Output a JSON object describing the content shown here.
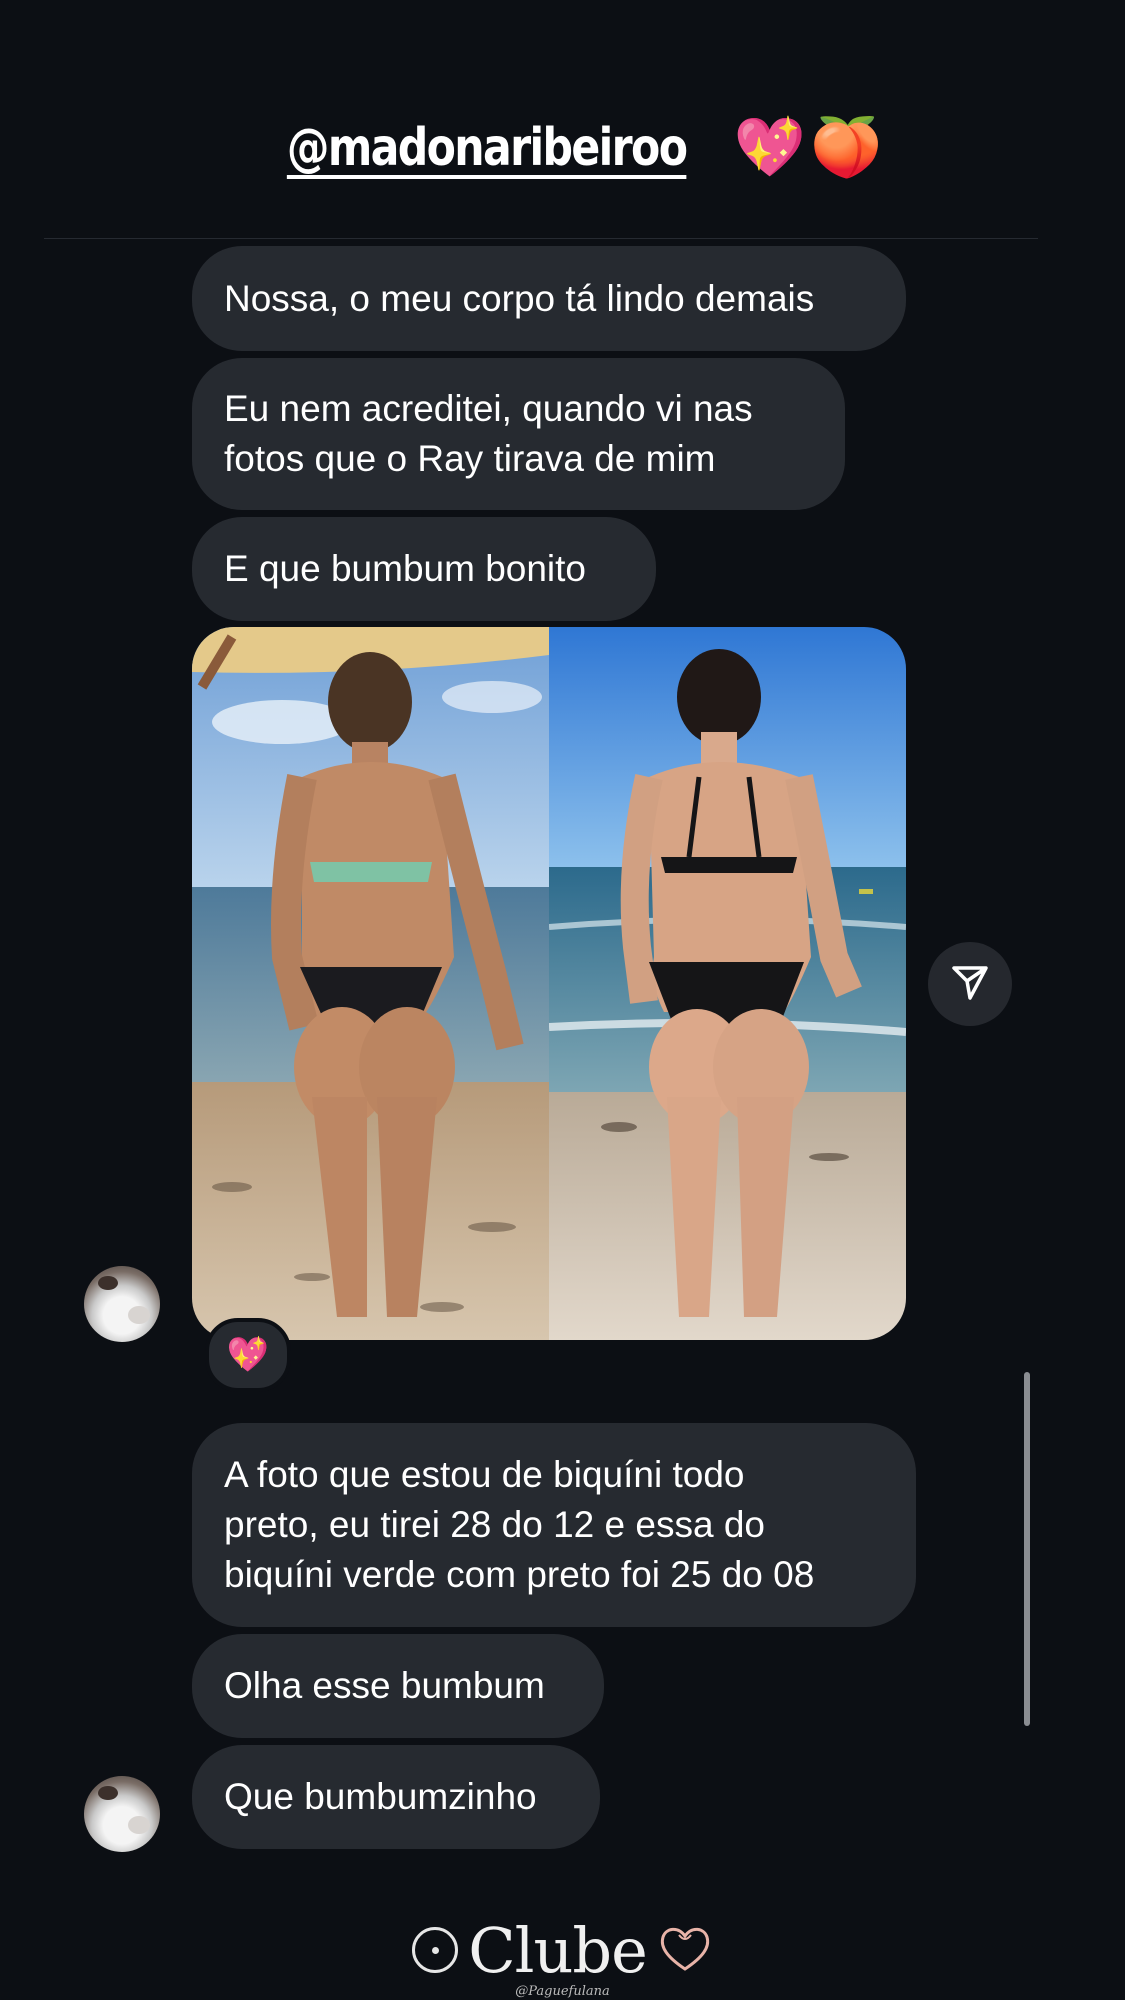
{
  "header": {
    "username": "@madonaribeiroo",
    "emoji_heart": "💖",
    "emoji_peach": "🍑"
  },
  "messages": [
    {
      "text": "Nossa, o meu corpo tá lindo demais"
    },
    {
      "lines": [
        "Eu nem acreditei, quando vi nas",
        "fotos que o Ray tirava de mim"
      ]
    },
    {
      "text": "E que bumbum bonito"
    },
    {
      "lines": [
        "A foto que estou de biquíni todo",
        "preto, eu tirei 28 do 12 e essa do",
        "biquíni verde com preto foi 25 do 08"
      ]
    },
    {
      "text": "Olha esse bumbum"
    },
    {
      "text": "Que bumbumzinho"
    }
  ],
  "photo_message": {
    "reaction": "💖",
    "share_icon": "send-icon"
  },
  "watermark": {
    "brand": "Clube",
    "sub": "@Paguefulana"
  },
  "colors": {
    "background": "#0c0f14",
    "bubble": "#262a30",
    "text": "#ffffff"
  }
}
